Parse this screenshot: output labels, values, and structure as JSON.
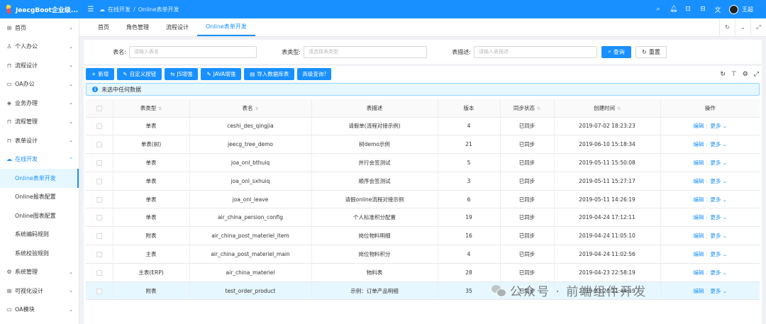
{
  "app": {
    "title": "JeecgBoot企业级...",
    "user_name": "王超"
  },
  "header": {
    "breadcrumb": [
      "在线开发",
      "/",
      "Online表单开发"
    ],
    "icons": [
      "search-icon",
      "bell-icon",
      "lock-icon",
      "lock-icon",
      "translate-icon"
    ]
  },
  "sidebar": {
    "items": [
      {
        "label": "首页",
        "icon": "grid-icon"
      },
      {
        "label": "个人办公",
        "icon": "user-icon"
      },
      {
        "label": "流程设计",
        "icon": "flow-icon"
      },
      {
        "label": "OA办公",
        "icon": "desktop-icon"
      },
      {
        "label": "业务办理",
        "icon": "stack-icon"
      },
      {
        "label": "流程管理",
        "icon": "flow-icon"
      },
      {
        "label": "表单设计",
        "icon": "form-icon"
      },
      {
        "label": "在线开发",
        "icon": "cloud-icon"
      }
    ],
    "subitems": [
      "Online表单开发",
      "Online报表配置",
      "Online图表配置",
      "系统编码规则",
      "系统校验规则"
    ],
    "bottom_items": [
      {
        "label": "系统管理",
        "icon": "gear-icon"
      },
      {
        "label": "可视化设计",
        "icon": "grid-icon"
      },
      {
        "label": "OA模块",
        "icon": "desktop-icon"
      }
    ]
  },
  "tabs": [
    "首页",
    "角色管理",
    "流程设计",
    "Online表单开发"
  ],
  "search": {
    "table_name_label": "表名:",
    "table_name_placeholder": "请输入表名",
    "table_type_label": "表类型:",
    "table_type_placeholder": "请选择表类型",
    "table_desc_label": "表描述:",
    "table_desc_placeholder": "请输入表描述",
    "query_label": "查询",
    "reset_label": "重置"
  },
  "toolbar": {
    "add": "新增",
    "custom_button": "自定义按钮",
    "js_enhance": "JS增强",
    "java_enhance": "JAVA增强",
    "import_db": "导入数据库表",
    "advanced_query": "高级查询?"
  },
  "alert": {
    "text": "未选中任何数据"
  },
  "table": {
    "columns": [
      "表类型",
      "表名",
      "表描述",
      "版本",
      "同步状态",
      "创建时间",
      "操作"
    ],
    "edit_label": "编辑",
    "more_label": "更多",
    "rows": [
      {
        "type": "单表",
        "name": "ceshi_des_qingjia",
        "desc": "请假单(流程对接示例)",
        "version": "4",
        "status": "已同步",
        "created": "2019-07-02 18:23:23"
      },
      {
        "type": "单表(树)",
        "name": "jeecg_tree_demo",
        "desc": "树demo示例",
        "version": "21",
        "status": "已同步",
        "created": "2019-06-10 15:18:34"
      },
      {
        "type": "单表",
        "name": "joa_onl_bthuiq",
        "desc": "并行会签测试",
        "version": "5",
        "status": "已同步",
        "created": "2019-05-11 15:50:08"
      },
      {
        "type": "单表",
        "name": "joa_onl_sxhuiq",
        "desc": "顺序会签测试",
        "version": "3",
        "status": "已同步",
        "created": "2019-05-11 15:27:17"
      },
      {
        "type": "单表",
        "name": "joa_onl_leave",
        "desc": "请假online流程对接示例",
        "version": "6",
        "status": "已同步",
        "created": "2019-05-11 14:26:19"
      },
      {
        "type": "单表",
        "name": "air_china_persion_config",
        "desc": "个人标准积分配置",
        "version": "19",
        "status": "已同步",
        "created": "2019-04-24 17:12:11"
      },
      {
        "type": "附表",
        "name": "air_china_post_materiel_item",
        "desc": "岗位物料明细",
        "version": "16",
        "status": "已同步",
        "created": "2019-04-24 11:05:10"
      },
      {
        "type": "主表",
        "name": "air_china_post_materiel_main",
        "desc": "岗位物料积分",
        "version": "4",
        "status": "已同步",
        "created": "2019-04-24 11:02:56"
      },
      {
        "type": "主表(ERP)",
        "name": "air_china_materiel",
        "desc": "物料表",
        "version": "28",
        "status": "已同步",
        "created": "2019-04-23 22:58:19"
      },
      {
        "type": "附表",
        "name": "test_order_product",
        "desc": "示例：订单产品明细",
        "version": "35",
        "status": "已同步",
        "created": "2019-03-20 11:44:19"
      }
    ]
  },
  "watermark": {
    "text": "公众号 · 前端组件开发"
  },
  "colors": {
    "primary": "#1890ff",
    "success": "#52c41a",
    "row_highlight": "#e6f7ff"
  }
}
